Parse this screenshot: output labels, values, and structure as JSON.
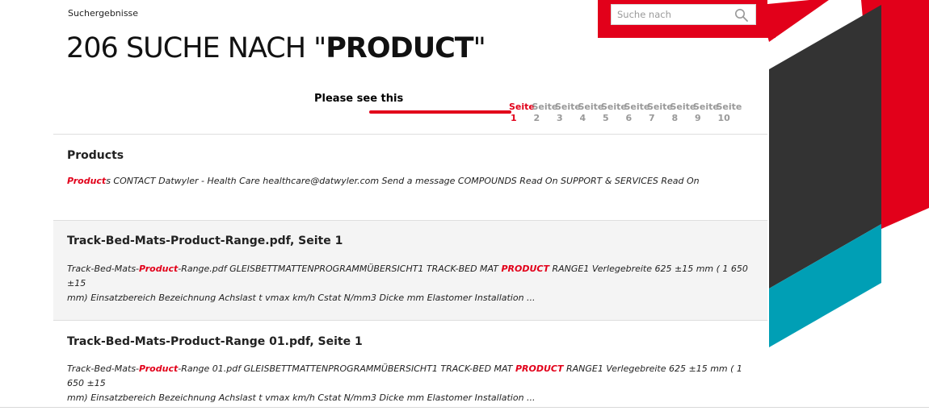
{
  "header": {
    "breadcrumb": "Suchergebnisse",
    "count": "206",
    "title_prefix": "SUCHE NACH \"",
    "query": "PRODUCT",
    "title_suffix": "\""
  },
  "search": {
    "placeholder": "Suche nach",
    "icon": "search-icon"
  },
  "annotation": {
    "note": "Please see this"
  },
  "pagination": {
    "pages": [
      {
        "word": "Seite",
        "num": "1",
        "active": true
      },
      {
        "word": "Seite",
        "num": "2"
      },
      {
        "word": "Seite",
        "num": "3"
      },
      {
        "word": "Seite",
        "num": "4"
      },
      {
        "word": "Seite",
        "num": "5"
      },
      {
        "word": "Seite",
        "num": "6"
      },
      {
        "word": "Seite",
        "num": "7"
      },
      {
        "word": "Seite",
        "num": "8"
      },
      {
        "word": "Seite",
        "num": "9"
      },
      {
        "word": "Seite",
        "num": "10"
      }
    ]
  },
  "results": [
    {
      "title": "Products",
      "snippet": [
        {
          "t": "Product",
          "hl": true
        },
        {
          "t": "s CONTACT Datwyler - Health Care healthcare@datwyler.com Send a message COMPOUNDS Read On SUPPORT & SERVICES Read On"
        }
      ]
    },
    {
      "title": "Track-Bed-Mats-Product-Range.pdf, Seite 1",
      "shaded": true,
      "snippet": [
        {
          "t": "Track-Bed-Mats-"
        },
        {
          "t": "Product",
          "hl": true
        },
        {
          "t": "-Range.pdf GLEISBETTMATTENPROGRAMMÜBERSICHT1 TRACK-BED MAT "
        },
        {
          "t": "PRODUCT",
          "hl": true
        },
        {
          "t": " RANGE1 Verlegebreite 625 ±15 mm ( 1 650 ±15\nmm) Einsatzbereich Bezeichnung Achslast t vmax km/h Cstat N/mm3 Dicke mm Elastomer Installation ..."
        }
      ]
    },
    {
      "title": "Track-Bed-Mats-Product-Range 01.pdf, Seite 1",
      "snippet": [
        {
          "t": "Track-Bed-Mats-"
        },
        {
          "t": "Product",
          "hl": true
        },
        {
          "t": "-Range 01.pdf GLEISBETTMATTENPROGRAMMÜBERSICHT1 TRACK-BED MAT "
        },
        {
          "t": "PRODUCT",
          "hl": true
        },
        {
          "t": " RANGE1 Verlegebreite 625 ±15 mm ( 1 650 ±15\nmm) Einsatzbereich Bezeichnung Achslast t vmax km/h Cstat N/mm3 Dicke mm Elastomer Installation ..."
        }
      ]
    }
  ],
  "colors": {
    "brand_red": "#e2001a",
    "dark_panel": "#333333",
    "teal_panel": "#009fb5",
    "page_inactive": "#999999",
    "shaded_row": "#f4f4f4"
  }
}
